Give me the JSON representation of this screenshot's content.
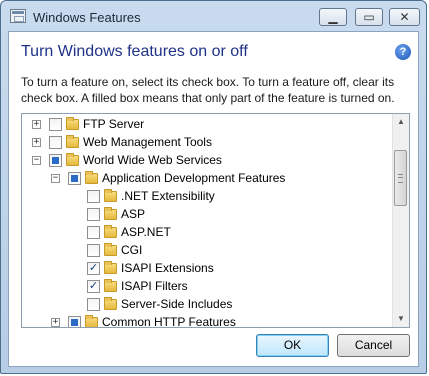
{
  "window": {
    "title": "Windows Features",
    "controls": {
      "minimize": "▁",
      "maximize": "▭",
      "close": "✕"
    }
  },
  "header": {
    "heading": "Turn Windows features on or off",
    "help_glyph": "?",
    "description": "To turn a feature on, select its check box. To turn a feature off, clear its check box. A filled box means that only part of the feature is turned on."
  },
  "tree": {
    "items": [
      {
        "label": "FTP Server",
        "level": 0,
        "expander": "+",
        "state": "unchecked"
      },
      {
        "label": "Web Management Tools",
        "level": 0,
        "expander": "+",
        "state": "unchecked"
      },
      {
        "label": "World Wide Web Services",
        "level": 0,
        "expander": "−",
        "state": "partial"
      },
      {
        "label": "Application Development Features",
        "level": 1,
        "expander": "−",
        "state": "partial"
      },
      {
        "label": ".NET Extensibility",
        "level": 2,
        "expander": "",
        "state": "unchecked"
      },
      {
        "label": "ASP",
        "level": 2,
        "expander": "",
        "state": "unchecked"
      },
      {
        "label": "ASP.NET",
        "level": 2,
        "expander": "",
        "state": "unchecked"
      },
      {
        "label": "CGI",
        "level": 2,
        "expander": "",
        "state": "unchecked"
      },
      {
        "label": "ISAPI Extensions",
        "level": 2,
        "expander": "",
        "state": "checked"
      },
      {
        "label": "ISAPI Filters",
        "level": 2,
        "expander": "",
        "state": "checked"
      },
      {
        "label": "Server-Side Includes",
        "level": 2,
        "expander": "",
        "state": "unchecked"
      },
      {
        "label": "Common HTTP Features",
        "level": 1,
        "expander": "+",
        "state": "partial"
      }
    ],
    "scroll": {
      "up": "▲",
      "down": "▼"
    }
  },
  "buttons": {
    "ok": "OK",
    "cancel": "Cancel"
  }
}
